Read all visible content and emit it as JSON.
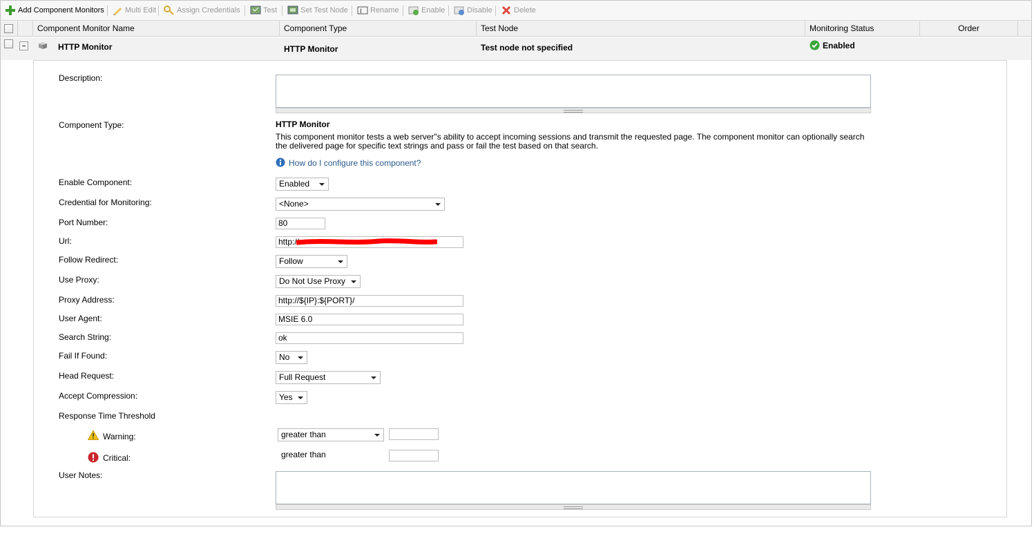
{
  "toolbar": {
    "add": "Add Component Monitors",
    "multi_edit": "Multi Edit",
    "assign_credentials": "Assign Credentials",
    "test": "Test",
    "set_test_node": "Set Test Node",
    "rename": "Rename",
    "enable": "Enable",
    "disable": "Disable",
    "delete": "Delete"
  },
  "columns": {
    "name": "Component Monitor Name",
    "type": "Component Type",
    "test_node": "Test Node",
    "status": "Monitoring Status",
    "order": "Order"
  },
  "row": {
    "name": "HTTP Monitor",
    "type": "HTTP Monitor",
    "test_node": "Test node not specified",
    "status": "Enabled"
  },
  "form": {
    "description_label": "Description:",
    "description_value": "",
    "component_type_label": "Component Type:",
    "component_type_value": "HTTP Monitor",
    "component_type_desc": "This component monitor tests a web server\"s ability to accept incoming sessions and transmit the requested page. The component monitor can optionally search the delivered page for specific text strings and pass or fail the test based on that search.",
    "help_link": "How do I configure this component?",
    "enable_label": "Enable Component:",
    "enable_value": "Enabled",
    "credential_label": "Credential for Monitoring:",
    "credential_value": "<None>",
    "port_label": "Port Number:",
    "port_value": "80",
    "url_label": "Url:",
    "url_value": "http://",
    "follow_label": "Follow Redirect:",
    "follow_value": "Follow",
    "proxy_label": "Use Proxy:",
    "proxy_value": "Do Not Use Proxy",
    "proxy_addr_label": "Proxy Address:",
    "proxy_addr_value": "http://${IP}:${PORT}/",
    "user_agent_label": "User Agent:",
    "user_agent_value": "MSIE 6.0",
    "search_label": "Search String:",
    "search_value": "ok",
    "fail_label": "Fail If Found:",
    "fail_value": "No",
    "head_label": "Head Request:",
    "head_value": "Full Request",
    "compression_label": "Accept Compression:",
    "compression_value": "Yes",
    "threshold_label": "Response Time Threshold",
    "warning_label": "Warning:",
    "warning_op": "greater than",
    "warning_value": "",
    "critical_label": "Critical:",
    "critical_op": "greater than",
    "critical_value": "",
    "notes_label": "User Notes:",
    "notes_value": ""
  },
  "colors": {
    "status_green": "#3aa53a",
    "redaction": "#ff0000",
    "link": "#2a5a8c"
  }
}
